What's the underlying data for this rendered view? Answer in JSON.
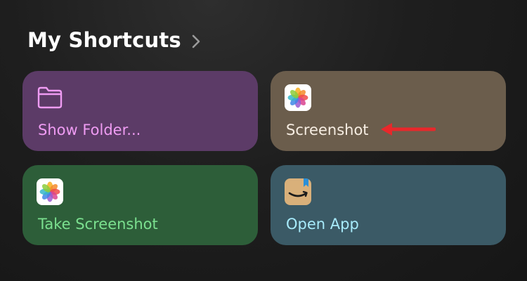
{
  "header": {
    "title": "My Shortcuts"
  },
  "shortcuts": [
    {
      "label": "Show Folder...",
      "icon": "folder-icon",
      "color": "#5c3b67",
      "label_color": "#ef9cf3"
    },
    {
      "label": "Screenshot",
      "icon": "photos-app-icon",
      "color": "#6b5d4c",
      "label_color": "#f6ede2"
    },
    {
      "label": "Take Screenshot",
      "icon": "photos-app-icon",
      "color": "#2d5e39",
      "label_color": "#7be08f"
    },
    {
      "label": "Open App",
      "icon": "amazon-app-icon",
      "color": "#3b5a66",
      "label_color": "#a7ebfb"
    }
  ],
  "annotation": {
    "icon": "red-arrow-icon",
    "color": "#e8282b"
  }
}
